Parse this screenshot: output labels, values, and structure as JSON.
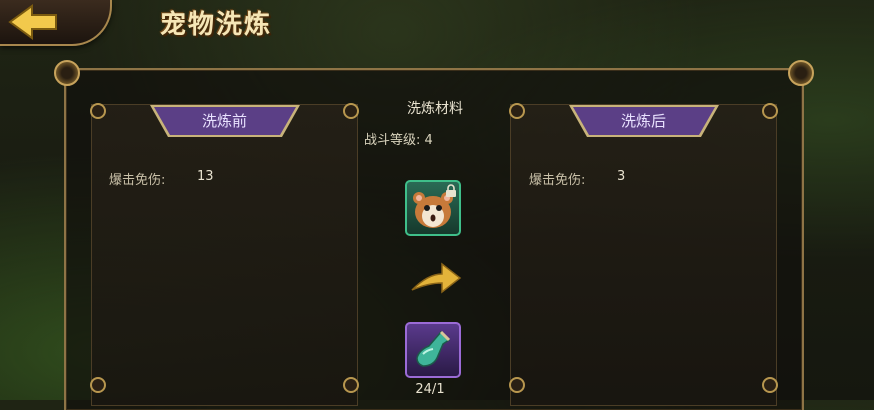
{
  "header": {
    "title": "宠物洗炼"
  },
  "left_panel": {
    "tab_label": "洗炼前",
    "stat_label": "爆击免伤:",
    "stat_value": "13"
  },
  "right_panel": {
    "tab_label": "洗炼后",
    "stat_label": "爆击免伤:",
    "stat_value": "3"
  },
  "materials": {
    "title": "洗炼材料",
    "combat_level": "战斗等级: 4",
    "potion_count": "24/1"
  },
  "icons": {
    "back": "back-arrow-icon",
    "pet": "hamster-pet-icon",
    "lock": "lock-icon",
    "transform": "right-arrow-icon",
    "potion": "green-potion-icon"
  },
  "colors": {
    "tab_purple": "#5b3f86",
    "gold_border": "#a8874d",
    "pet_slot_green": "#3fbf8a",
    "potion_slot_purple": "#9b6bd6"
  }
}
